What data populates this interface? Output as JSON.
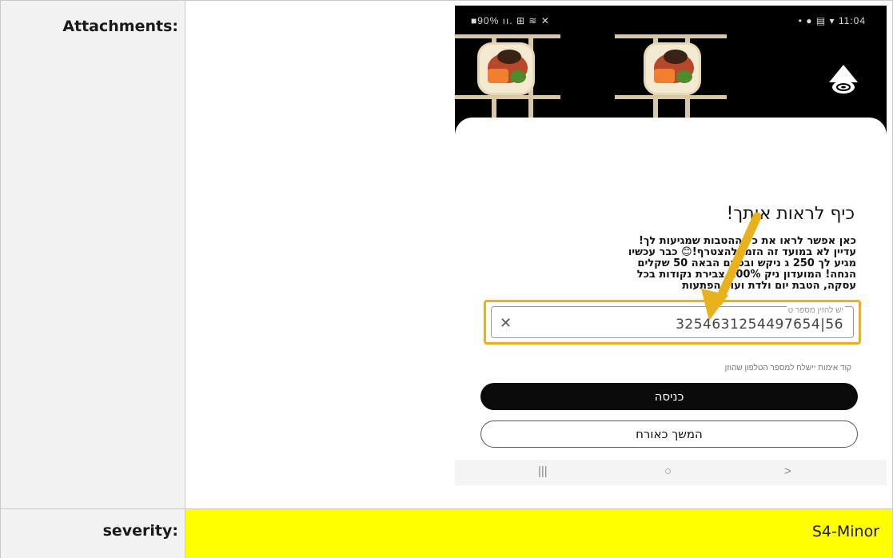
{
  "rows": {
    "attachments": {
      "label": "Attachments:"
    },
    "severity": {
      "label": "severity:",
      "value": "S4-Minor",
      "highlight_color": "#ffff00"
    }
  },
  "phone": {
    "status_bar": {
      "left": "90% ",
      "time": "11:04"
    },
    "title": "כיף לראות אותך!",
    "body_lines": [
      "כאן אפשר לראו  את כל ההטבות שמגיעות לך!",
      "עדיין לא במועד  זה הזמן להצטרף!😊 כבר עכשיו",
      "מגיע לך 250 ג  ניקש ובפעם הבאה 50 שקלים",
      "הנחה! המועדון  ניק 100% צבירת נקודות בכל",
      "עסקה, הטבת יום  ולדת ועוד הפתעות"
    ],
    "phone_field": {
      "label": "יש להזין מספר ט",
      "value": "3254631254497654|56",
      "clear_icon": "✕"
    },
    "hint": "קוד אימות יישלח למספר הטלפון שהוזן",
    "enter_button": "כניסה",
    "guest_button": "המשך כאורח",
    "nav": {
      "recents": "|||",
      "home": "○",
      "back": ">"
    },
    "annotation_color": "#e8b21c"
  }
}
